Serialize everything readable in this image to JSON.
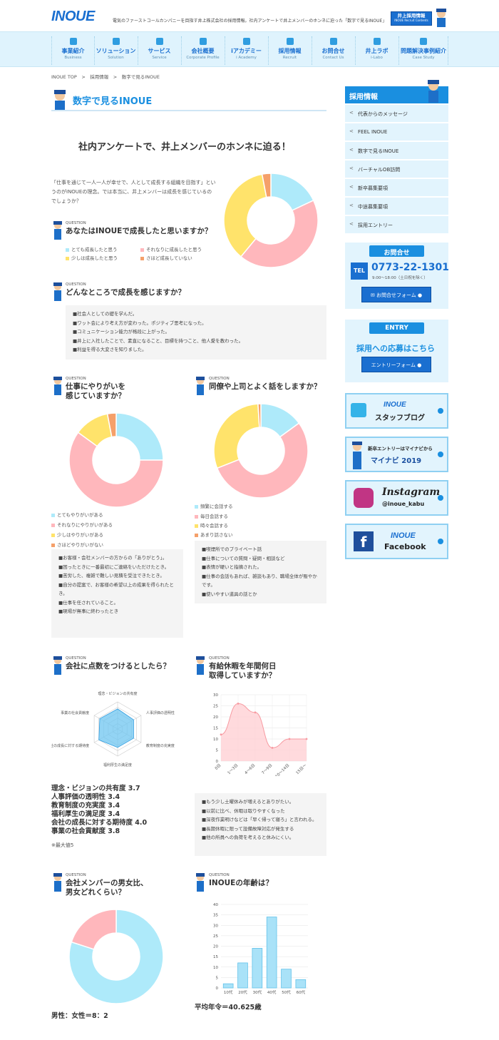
{
  "header": {
    "logo": "INOUE",
    "tagline": "電気のファーストコールカンパニーを目指す井上株式会社の採用情報。社内アンケートで井上メンバーのホンネに迫った「数字で見るINOUE」",
    "badge_title": "井上採用情報",
    "badge_sub": "INOUE Recruit Contents"
  },
  "nav": [
    {
      "jp": "事業紹介",
      "en": "Business"
    },
    {
      "jp": "ソリューション",
      "en": "Solution"
    },
    {
      "jp": "サービス",
      "en": "Service"
    },
    {
      "jp": "会社概要",
      "en": "Corporate Profile"
    },
    {
      "jp": "iアカデミー",
      "en": "i Academy"
    },
    {
      "jp": "採用情報",
      "en": "Recruit"
    },
    {
      "jp": "お問合せ",
      "en": "Contact Us"
    },
    {
      "jp": "井上ラボ",
      "en": "i-Labo"
    },
    {
      "jp": "問題解決事例紹介",
      "en": "Case Study"
    }
  ],
  "breadcrumb": "INOUE TOP　>　採用情報　>　数字で見るINOUE",
  "page_title": "数字で見るINOUE",
  "lead": "社内アンケートで、井上メンバーのホンネに迫る！",
  "intro": "「仕事を通じて一人一人が幸せで、人として成長する組織を目指す」というのがINOUEの理念。では本当に、井上メンバーは成長を感じているのでしょうか？",
  "question_label": "QUESTION",
  "colors": {
    "cyan": "#aeeafa",
    "pink": "#ffb7bc",
    "yellow": "#ffe36b",
    "orange": "#f5a06a",
    "blue": "#1a8fe0"
  },
  "q1": {
    "title": "あなたはINOUEで成長したと思いますか？",
    "legend": [
      "とても成長したと思う",
      "それなりに成長したと思う",
      "少しは成長したと思う",
      "さほど成長していない"
    ]
  },
  "q2": {
    "title": "どんなところで成長を感じますか？",
    "answers": [
      "■社会人としての礎を学んだ。",
      "■ワット会により考え方が変わった。ポジティブ思考になった。",
      "■コミュニケーション能力が格段に上がった。",
      "■井上に入社したことで、素直になること、目標を持つこと、他人愛を教わった。",
      "■利益を得る大変さを知りました。"
    ]
  },
  "q3": {
    "title_1": "仕事にやりがいを",
    "title_2": "感じていますか？",
    "legend": [
      "とてもやりがいがある",
      "それなりにやりがいがある",
      "少しはやりがいがある",
      "さほどやりがいがない"
    ],
    "answers": [
      "■お客様・会社メンバーの方からの「ありがとう」。",
      "■困ったときに一番最初にご連絡をいただけたとき。",
      "■苦労した、複雑で難しい見積を受注できたとき。",
      "■自分の提案で、お客様の希望以上の成果を得られたとき。",
      "■仕事を任されていること。",
      "■現場が無事に終わったとき"
    ]
  },
  "q4": {
    "title": "同僚や上司とよく話をしますか？",
    "legend": [
      "頻繁に会話する",
      "毎日会話する",
      "時々会話する",
      "あまり話さない"
    ],
    "answers": [
      "■喫煙所でのプライベート話",
      "■仕事についての質問・疑問・相談など",
      "■表情が硬いと指摘された。",
      "■仕事の会話もあれば、雑談もあり、職場全体が賑やかです。",
      "■使いやすい道具の話とか"
    ]
  },
  "q5": {
    "title": "会社に点数をつけるとしたら？",
    "scores": [
      "理念・ビジョンの共有度 3.7",
      "人事評価の透明性 3.4",
      "教育制度の充実度 3.4",
      "福利厚生の満足度 3.4",
      "会社の成長に対する期待度 4.0",
      "事業の社会貢献度 3.8"
    ],
    "note": "※最大値5"
  },
  "q6": {
    "title_1": "有給休暇を年間何日",
    "title_2": "取得していますか？",
    "answers": [
      "■もう少し土曜休みが増えるとありがたい。",
      "■以前に比べ、休暇は取りやすくなった",
      "■深夜作業明けなどは「早く帰って寝ろ」と言われる。",
      "■長期休暇に限って設備故障対応が発生する",
      "■他の所員への負荷を考えると休みにくい。"
    ]
  },
  "q7": {
    "title_1": "会社メンバーの男女比、",
    "title_2": "男女どれくらい？",
    "ratio": "男性：女性＝8：2"
  },
  "q8": {
    "title": "INOUEの年齢は？",
    "average": "平均年令＝40.625歳"
  },
  "chart_data": [
    {
      "type": "pie",
      "categories": [
        "とても成長したと思う",
        "それなりに成長したと思う",
        "少しは成長したと思う",
        "さほど成長していない"
      ],
      "values": [
        18,
        43,
        36,
        3
      ]
    },
    {
      "type": "pie",
      "categories": [
        "とてもやりがいがある",
        "それなりにやりがいがある",
        "少しはやりがいがある",
        "さほどやりがいがない"
      ],
      "values": [
        25,
        60,
        12,
        3
      ]
    },
    {
      "type": "pie",
      "categories": [
        "頻繁に会話する",
        "毎日会話する",
        "時々会話する",
        "あまり話さない"
      ],
      "values": [
        15,
        54,
        30,
        1
      ]
    },
    {
      "type": "radar",
      "categories": [
        "理念・ビジョンの共有度",
        "人事評価の透明性",
        "教育制度の充実度",
        "福利厚生の満足度",
        "会社の成長に対する期待度",
        "事業の社会貢献度"
      ],
      "values": [
        3.7,
        3.4,
        3.4,
        3.4,
        4.0,
        3.8
      ],
      "max": 5
    },
    {
      "type": "line",
      "categories": [
        "0日",
        "1〜3日",
        "4〜6日",
        "7〜9日",
        "10〜14日",
        "15日〜"
      ],
      "values": [
        12,
        26,
        22,
        6,
        10,
        10
      ],
      "ylim": [
        0,
        30
      ],
      "yticks": [
        0,
        5,
        10,
        15,
        20,
        25,
        30
      ]
    },
    {
      "type": "pie",
      "categories": [
        "男性",
        "女性"
      ],
      "values": [
        80,
        20
      ]
    },
    {
      "type": "bar",
      "categories": [
        "10代",
        "20代",
        "30代",
        "40代",
        "50代",
        "60代"
      ],
      "values": [
        2,
        12,
        19,
        34,
        9,
        4
      ],
      "ylim": [
        0,
        40
      ],
      "yticks": [
        0,
        5,
        10,
        15,
        20,
        25,
        30,
        35,
        40
      ]
    }
  ],
  "sidebar": {
    "title": "採用情報",
    "items": [
      "代表からのメッセージ",
      "FEEL INOUE",
      "数字で見るINOUE",
      "バーチャルOB訪問",
      "新卒募集要項",
      "中途募集要項",
      "採用エントリー"
    ],
    "contact_title": "お問合せ",
    "tel_label": "TEL",
    "tel": "0773-22-1301",
    "hours": "9:00〜18:00（土日祝を除く）",
    "contact_button": "お問合せフォーム",
    "entry_title": "ENTRY",
    "entry_lead": "採用への応募はこちら",
    "entry_button": "エントリーフォーム",
    "banners": [
      {
        "l1": "INOUE",
        "l2": "スタッフブログ"
      },
      {
        "l1": "新卒エントリーはマイナビから",
        "l2": "マイナビ 2019"
      },
      {
        "l1": "Instagram",
        "l2": "@inoue_kabu"
      },
      {
        "l1": "INOUE",
        "l2": "Facebook"
      }
    ]
  }
}
